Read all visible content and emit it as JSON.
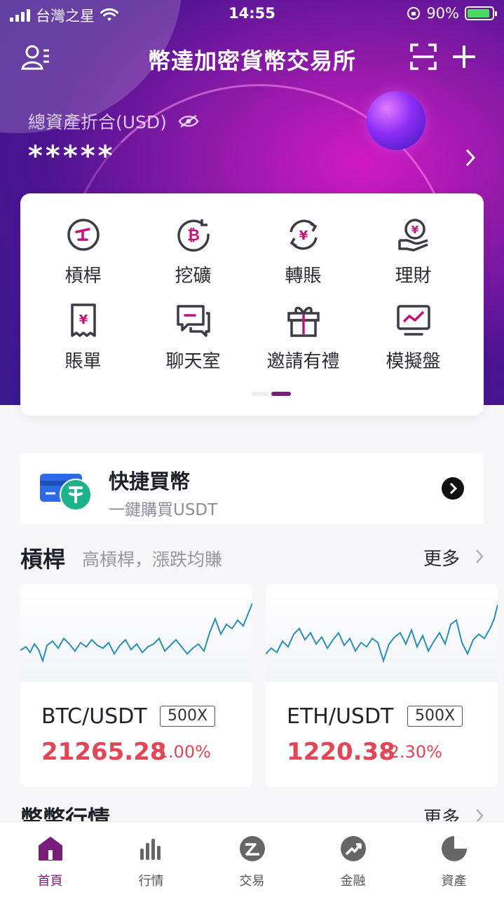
{
  "status_bar": {
    "carrier": "台灣之星",
    "time": "14:55",
    "battery": "90%"
  },
  "header": {
    "title": "幣達加密貨幣交易所",
    "icons": [
      "user-menu-icon",
      "scan-icon",
      "plus-icon"
    ]
  },
  "assets": {
    "label": "總資產折合(USD)",
    "value": "*****"
  },
  "functions": {
    "items": [
      {
        "label": "槓桿",
        "icon": "leverage-icon"
      },
      {
        "label": "挖礦",
        "icon": "mining-icon"
      },
      {
        "label": "轉賬",
        "icon": "transfer-icon"
      },
      {
        "label": "理財",
        "icon": "finance-icon"
      },
      {
        "label": "賬單",
        "icon": "bill-icon"
      },
      {
        "label": "聊天室",
        "icon": "chat-icon"
      },
      {
        "label": "邀請有禮",
        "icon": "gift-icon"
      },
      {
        "label": "模擬盤",
        "icon": "simulator-icon"
      }
    ],
    "page_index": 2,
    "page_count": 2
  },
  "quick_buy": {
    "title": "快捷買幣",
    "subtitle": "一鍵購買USDT"
  },
  "leverage_section": {
    "title": "槓桿",
    "description": "高槓桿，漲跌均賺",
    "more": "更多"
  },
  "markets": [
    {
      "pair": "BTC/USDT",
      "leverage": "500X",
      "price": "21265.28",
      "change": "-1.00%"
    },
    {
      "pair": "ETH/USDT",
      "leverage": "500X",
      "price": "1220.38",
      "change": "-2.30%"
    }
  ],
  "currency_section": {
    "title": "幣幣行情",
    "more": "更多"
  },
  "tabs": [
    {
      "label": "首頁",
      "icon": "home-icon",
      "active": true
    },
    {
      "label": "行情",
      "icon": "market-icon",
      "active": false
    },
    {
      "label": "交易",
      "icon": "trade-icon",
      "active": false
    },
    {
      "label": "金融",
      "icon": "finance-tab-icon",
      "active": false
    },
    {
      "label": "資產",
      "icon": "assets-icon",
      "active": false
    }
  ],
  "colors": {
    "brand_purple": "#7a1d7a",
    "accent_magenta": "#d21ac0",
    "down_red": "#e24556",
    "chart_line": "#2a8fb5"
  }
}
